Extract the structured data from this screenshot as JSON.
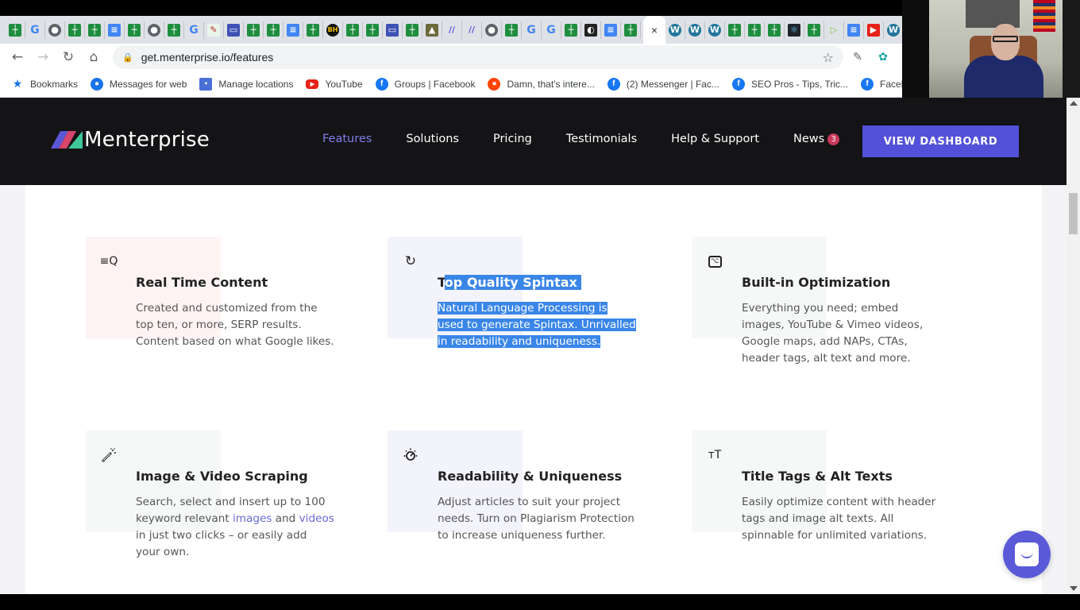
{
  "browser": {
    "tabs": [
      {
        "icon": "sheets-icon",
        "glyph": "┼"
      },
      {
        "icon": "google-icon",
        "glyph": "G"
      },
      {
        "icon": "globe-icon",
        "glyph": "●"
      },
      {
        "icon": "sheets-icon",
        "glyph": "┼"
      },
      {
        "icon": "sheets-icon",
        "glyph": "┼"
      },
      {
        "icon": "docs-icon",
        "glyph": "≡"
      },
      {
        "icon": "sheets-icon",
        "glyph": "┼"
      },
      {
        "icon": "globe-icon",
        "glyph": "●"
      },
      {
        "icon": "sheets-icon",
        "glyph": "┼"
      },
      {
        "icon": "google-icon",
        "glyph": "G"
      },
      {
        "icon": "edit-icon",
        "glyph": "✎"
      },
      {
        "icon": "forms-icon",
        "glyph": "▭"
      },
      {
        "icon": "sheets-icon",
        "glyph": "┼"
      },
      {
        "icon": "sheets-icon",
        "glyph": "┼"
      },
      {
        "icon": "docs-icon",
        "glyph": "≡"
      },
      {
        "icon": "sheets-icon",
        "glyph": "┼"
      },
      {
        "icon": "bhw-icon",
        "glyph": "BH"
      },
      {
        "icon": "sheets-icon",
        "glyph": "┼"
      },
      {
        "icon": "sheets-icon",
        "glyph": "┼"
      },
      {
        "icon": "forms-icon",
        "glyph": "▭"
      },
      {
        "icon": "sheets-icon",
        "glyph": "┼"
      },
      {
        "icon": "photo-icon",
        "glyph": "▲"
      },
      {
        "icon": "menterprise-icon",
        "glyph": "//"
      },
      {
        "icon": "menterprise-icon",
        "glyph": "//"
      },
      {
        "icon": "globe-icon",
        "glyph": "●"
      },
      {
        "icon": "sheets-icon",
        "glyph": "┼"
      },
      {
        "icon": "google-icon",
        "glyph": "G"
      },
      {
        "icon": "google-icon",
        "glyph": "G"
      },
      {
        "icon": "sheets-icon",
        "glyph": "┼"
      },
      {
        "icon": "dark-icon",
        "glyph": "◐"
      },
      {
        "icon": "docs-icon",
        "glyph": "≡"
      },
      {
        "icon": "sheets-icon",
        "glyph": "┼"
      }
    ],
    "active_tab_close": "×",
    "tabs_after": [
      {
        "icon": "wordpress-icon",
        "glyph": "W"
      },
      {
        "icon": "wordpress-icon",
        "glyph": "W"
      },
      {
        "icon": "wordpress-icon",
        "glyph": "W"
      },
      {
        "icon": "sheets-icon",
        "glyph": "┼"
      },
      {
        "icon": "sheets-icon",
        "glyph": "┼"
      },
      {
        "icon": "sheets-icon",
        "glyph": "┼"
      },
      {
        "icon": "react-icon",
        "glyph": "⚛"
      },
      {
        "icon": "sheets-icon",
        "glyph": "┼"
      },
      {
        "icon": "play-icon",
        "glyph": "▷"
      },
      {
        "icon": "docs-icon",
        "glyph": "≡"
      },
      {
        "icon": "youtube-icon",
        "glyph": "▶"
      },
      {
        "icon": "wordpress-icon",
        "glyph": "W"
      }
    ],
    "url": "get.menterprise.io/features",
    "nav": {
      "back": "←",
      "forward": "→",
      "reload": "↻",
      "home": "⌂",
      "star": "☆",
      "ext1": "✎",
      "ext2": "✿"
    },
    "bookmarks": [
      {
        "label": "Bookmarks",
        "icon": "star-icon",
        "glyph": "★"
      },
      {
        "label": "Messages for web",
        "icon": "messages-icon",
        "glyph": "●"
      },
      {
        "label": "Manage locations",
        "icon": "locations-icon",
        "glyph": "▪"
      },
      {
        "label": "YouTube",
        "icon": "youtube-icon",
        "glyph": "▶"
      },
      {
        "label": "Groups | Facebook",
        "icon": "facebook-icon",
        "glyph": "f"
      },
      {
        "label": "Damn, that's intere...",
        "icon": "reddit-icon",
        "glyph": "●"
      },
      {
        "label": "(2) Messenger | Fac...",
        "icon": "facebook-icon",
        "glyph": "f"
      },
      {
        "label": "SEO Pros - Tips, Tric...",
        "icon": "facebook-icon",
        "glyph": "f"
      },
      {
        "label": "Facebook",
        "icon": "facebook-icon",
        "glyph": "f"
      }
    ]
  },
  "site": {
    "brand": "Menterprise",
    "nav": [
      {
        "label": "Features",
        "active": true
      },
      {
        "label": "Solutions"
      },
      {
        "label": "Pricing"
      },
      {
        "label": "Testimonials"
      },
      {
        "label": "Help & Support"
      },
      {
        "label": "News",
        "badge": "3"
      }
    ],
    "cta": "VIEW DASHBOARD",
    "colors": {
      "accent": "#5351d9",
      "active_nav": "#7f7de9",
      "badge": "#c8385a",
      "header_bg": "#141316",
      "selection": "#3a86e8"
    }
  },
  "features": [
    {
      "icon": "search-text-icon",
      "glyph": "≡Q",
      "title": "Real Time Content",
      "desc": "Created and customized from the top ten, or more, SERP results. Content based on what Google likes."
    },
    {
      "icon": "refresh-cycle-icon",
      "glyph": "↻",
      "title_prefix": "T",
      "title_selected": "op Quality Spintax",
      "desc": "Natural Language Processing is used to generate Spintax. Unrivalled in readability and uniqueness."
    },
    {
      "icon": "terminal-box-icon",
      "glyph": "⌥",
      "title": "Built-in Optimization",
      "desc": "Everything you need; embed images, YouTube & Vimeo videos, Google maps, add NAPs, CTAs, header tags, alt text and more."
    },
    {
      "icon": "magic-wand-icon",
      "glyph": "⁂",
      "title": "Image & Video Scraping",
      "desc_before": "Search, select and insert up to 100 keyword relevant ",
      "link1": "images",
      "desc_mid": " and ",
      "link2": "videos",
      "desc_after": " in just two clicks – or easily add your own."
    },
    {
      "icon": "gauge-icon",
      "glyph": "◌",
      "title": "Readability & Uniqueness",
      "desc": "Adjust articles to suit your project needs. Turn on Plagiarism Protection to increase uniqueness further."
    },
    {
      "icon": "text-size-icon",
      "glyph": "ᴛT",
      "title": "Title Tags & Alt Texts",
      "desc": "Easily optimize content with header tags and image alt texts. All spinnable for unlimited variations."
    }
  ]
}
